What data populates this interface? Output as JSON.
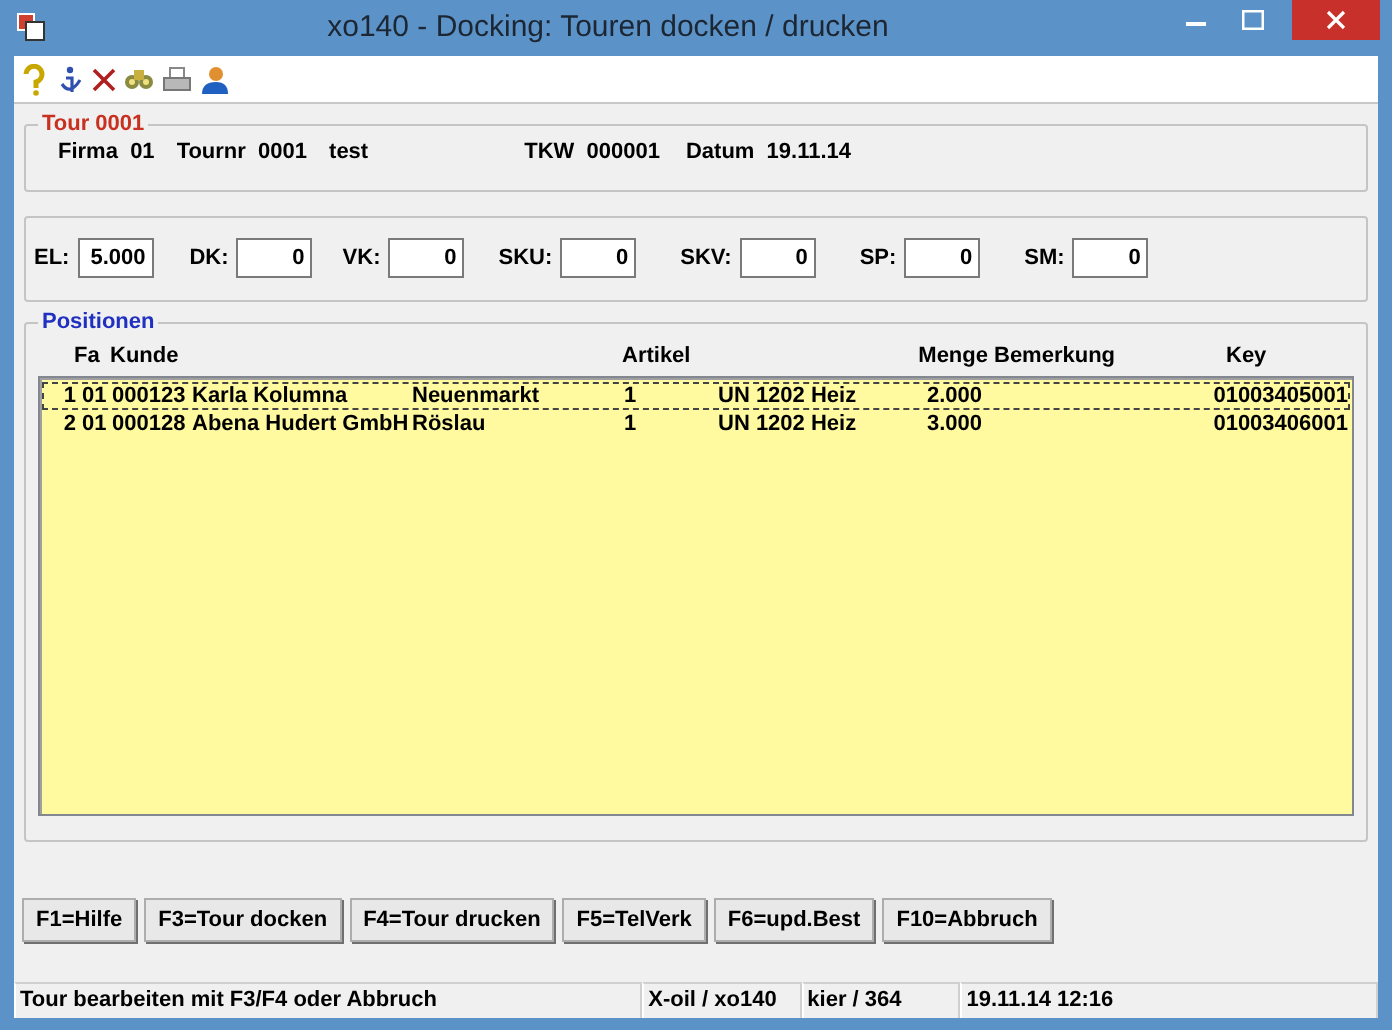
{
  "window": {
    "title": "xo140 - Docking: Touren docken / drucken"
  },
  "tour": {
    "legend": "Tour 0001",
    "fields": [
      {
        "label": "Firma",
        "value": "01"
      },
      {
        "label": "Tournr",
        "value": "0001"
      },
      {
        "value": "test"
      },
      {
        "label": "TKW",
        "value": "000001"
      },
      {
        "label": "Datum",
        "value": "19.11.14"
      }
    ]
  },
  "counters": [
    {
      "label": "EL:",
      "value": "5.000"
    },
    {
      "label": "DK:",
      "value": "0"
    },
    {
      "label": "VK:",
      "value": "0"
    },
    {
      "label": "SKU:",
      "value": "0"
    },
    {
      "label": "SKV:",
      "value": "0"
    },
    {
      "label": "SP:",
      "value": "0"
    },
    {
      "label": "SM:",
      "value": "0"
    }
  ],
  "positions": {
    "legend": "Positionen",
    "columns": [
      "",
      "Fa",
      "Kunde",
      "",
      "",
      "Artikel",
      "",
      "Menge",
      "Bemerkung",
      "Key"
    ],
    "rows": [
      {
        "selected": true,
        "cells": [
          "1",
          "01",
          "000123",
          "Karla Kolumna",
          "Neuenmarkt",
          "1",
          "UN 1202 Heiz",
          "2.000",
          "",
          "01003405001"
        ]
      },
      {
        "selected": false,
        "cells": [
          "2",
          "01",
          "000128",
          "Abena Hudert GmbH",
          "Röslau",
          "1",
          "UN 1202 Heiz",
          "3.000",
          "",
          "01003406001"
        ]
      }
    ]
  },
  "buttons": [
    "F1=Hilfe",
    "F3=Tour docken",
    "F4=Tour drucken",
    "F5=TelVerk",
    "F6=upd.Best",
    "F10=Abbruch"
  ],
  "status_bar": [
    "Tour bearbeiten mit F3/F4 oder Abbruch",
    "X-oil / xo140",
    "kier / 364",
    "19.11.14 12:16"
  ]
}
